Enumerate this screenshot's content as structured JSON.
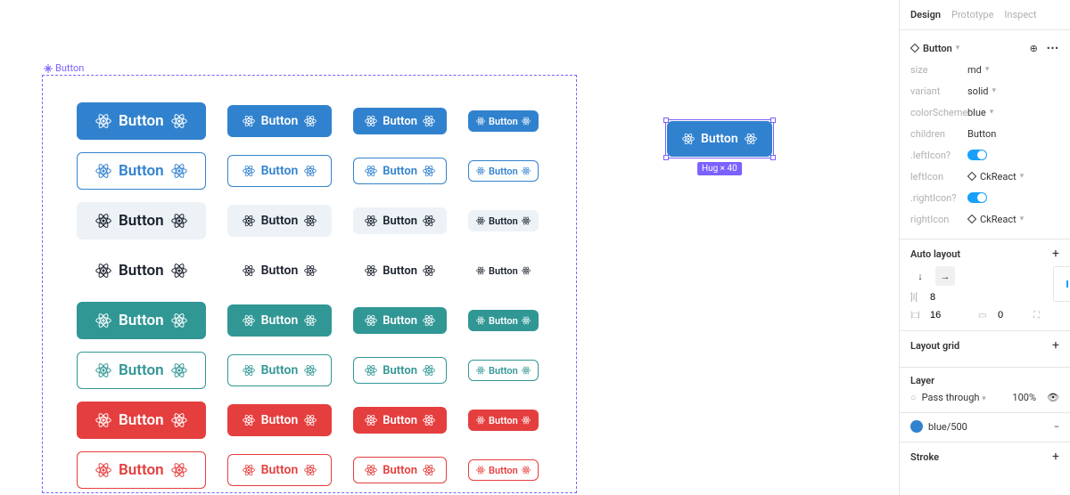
{
  "frame_label": "Button",
  "button_text": "Button",
  "selected": {
    "text": "Button",
    "dim": "Hug × 40"
  },
  "sidebar": {
    "tabs": {
      "design": "Design",
      "prototype": "Prototype",
      "inspect": "Inspect"
    },
    "component": {
      "name": "Button"
    },
    "props": {
      "size_lbl": "size",
      "size_val": "md",
      "variant_lbl": "variant",
      "variant_val": "solid",
      "scheme_lbl": "colorScheme",
      "scheme_val": "blue",
      "children_lbl": "children",
      "children_val": "Button",
      "leftIconTgl_lbl": ".leftIcon?",
      "leftIcon_lbl": "leftIcon",
      "leftIcon_val": "CkReact",
      "rightIconTgl_lbl": ".rightIcon?",
      "rightIcon_lbl": "rightIcon",
      "rightIcon_val": "CkReact"
    },
    "auto_layout": {
      "title": "Auto layout",
      "spacing": "8",
      "padding": "16",
      "pad2": "0"
    },
    "layout_grid": {
      "title": "Layout grid"
    },
    "layer": {
      "title": "Layer",
      "blend": "Pass through",
      "opacity": "100%"
    },
    "fill": {
      "swatch": "#3182ce",
      "name": "blue/500"
    },
    "stroke": {
      "title": "Stroke"
    }
  }
}
